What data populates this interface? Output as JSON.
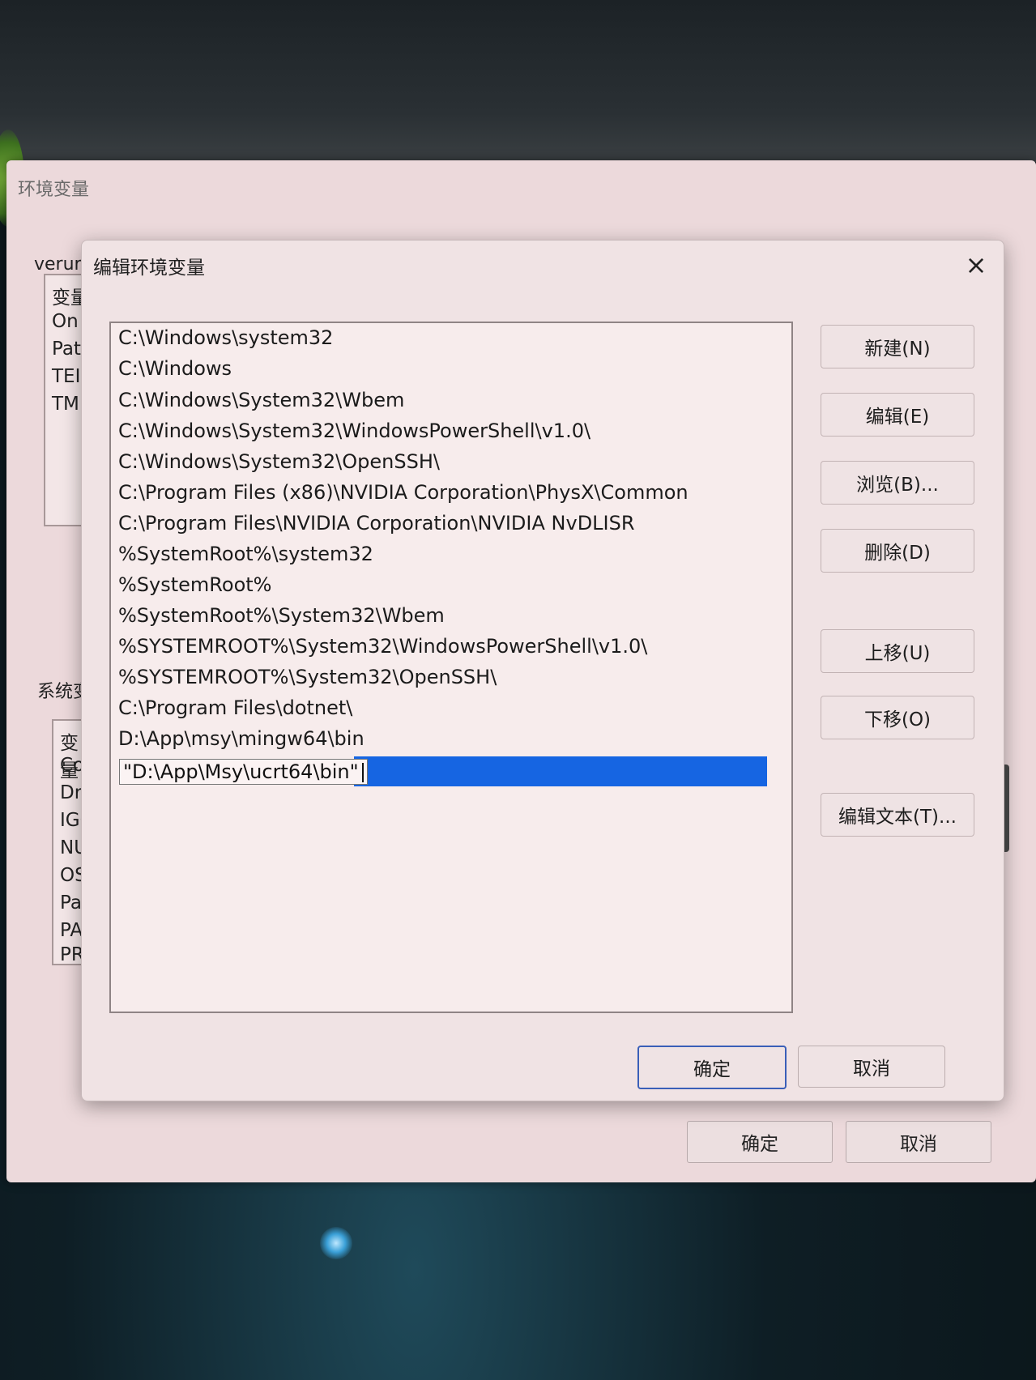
{
  "background_window": {
    "title": "环境变量",
    "user_section_label": "verur",
    "user_vars_list": [
      "变量",
      "On",
      "Pat",
      "TEI",
      "TM"
    ],
    "system_section_label": "系统变",
    "system_vars_list": [
      "变量",
      "Co",
      "Dri",
      "IGC",
      "NU",
      "OS",
      "Pa",
      "PA",
      "PR"
    ],
    "ok_label": "确定",
    "cancel_label": "取消"
  },
  "dialog": {
    "title": "编辑环境变量",
    "close_icon": "×",
    "paths": [
      "C:\\Windows\\system32",
      "C:\\Windows",
      "C:\\Windows\\System32\\Wbem",
      "C:\\Windows\\System32\\WindowsPowerShell\\v1.0\\",
      "C:\\Windows\\System32\\OpenSSH\\",
      "C:\\Program Files (x86)\\NVIDIA Corporation\\PhysX\\Common",
      "C:\\Program Files\\NVIDIA Corporation\\NVIDIA NvDLISR",
      "%SystemRoot%\\system32",
      "%SystemRoot%",
      "%SystemRoot%\\System32\\Wbem",
      "%SYSTEMROOT%\\System32\\WindowsPowerShell\\v1.0\\",
      "%SYSTEMROOT%\\System32\\OpenSSH\\",
      "C:\\Program Files\\dotnet\\",
      "D:\\App\\msy\\mingw64\\bin"
    ],
    "editing_value": "\"D:\\App\\Msy\\ucrt64\\bin\"",
    "buttons": {
      "new": "新建(N)",
      "edit": "编辑(E)",
      "browse": "浏览(B)...",
      "delete": "删除(D)",
      "move_up": "上移(U)",
      "move_down": "下移(O)",
      "edit_text": "编辑文本(T)..."
    },
    "ok_label": "确定",
    "cancel_label": "取消"
  },
  "colors": {
    "selection": "#1665e2",
    "dialog_bg": "#f0e3e4",
    "window_bg": "#ecd9db"
  }
}
